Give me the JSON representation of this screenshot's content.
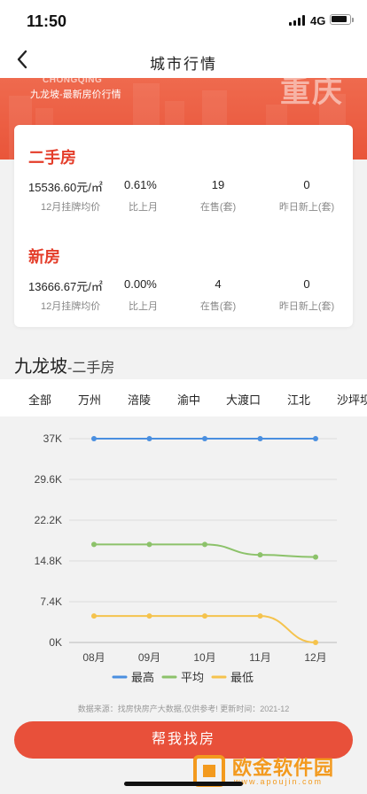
{
  "status_bar": {
    "time": "11:50",
    "network": "4G"
  },
  "nav": {
    "title": "城市行情"
  },
  "banner": {
    "city_en": "CHONGQING",
    "subtitle": "九龙坡-最新房价行情",
    "city_cn": "重庆"
  },
  "second_hand": {
    "title": "二手房",
    "avg_price": "15536.60元/㎡",
    "avg_price_label": "12月挂牌均价",
    "change": "0.61%",
    "change_label": "比上月",
    "on_sale": "19",
    "on_sale_label": "在售(套)",
    "new_listed": "0",
    "new_listed_label": "昨日新上(套)"
  },
  "new_house": {
    "title": "新房",
    "avg_price": "13666.67元/㎡",
    "avg_price_label": "12月挂牌均价",
    "change": "0.00%",
    "change_label": "比上月",
    "on_sale": "4",
    "on_sale_label": "在售(套)",
    "new_listed": "0",
    "new_listed_label": "昨日新上(套)"
  },
  "district": {
    "name": "九龙坡",
    "suffix": "-二手房"
  },
  "tabs": [
    "全部",
    "万州",
    "涪陵",
    "渝中",
    "大渡口",
    "江北",
    "沙坪坝"
  ],
  "chart_data": {
    "type": "line",
    "categories": [
      "08月",
      "09月",
      "10月",
      "11月",
      "12月"
    ],
    "y_ticks": [
      "0K",
      "7.4K",
      "14.8K",
      "22.2K",
      "29.6K",
      "37K"
    ],
    "ylim": [
      0,
      37000
    ],
    "grid": true,
    "legend_position": "bottom",
    "series": [
      {
        "name": "最高",
        "color": "#4a8fe0",
        "values": [
          37000,
          37000,
          37000,
          37000,
          37000
        ]
      },
      {
        "name": "平均",
        "color": "#8cc26a",
        "values": [
          17800,
          17800,
          17800,
          15900,
          15500
        ]
      },
      {
        "name": "最低",
        "color": "#f5c34d",
        "values": [
          4800,
          4800,
          4800,
          4800,
          0
        ]
      }
    ]
  },
  "source_note": "数据来源：找房快房产大数据,仅供参考! 更新时间：2021-12",
  "cta": {
    "label": "帮我找房"
  },
  "watermark": {
    "text": "欧金软件园",
    "url": "www.apoujin.com"
  },
  "colors": {
    "accent": "#e8503a",
    "title_red": "#e43d2a"
  }
}
